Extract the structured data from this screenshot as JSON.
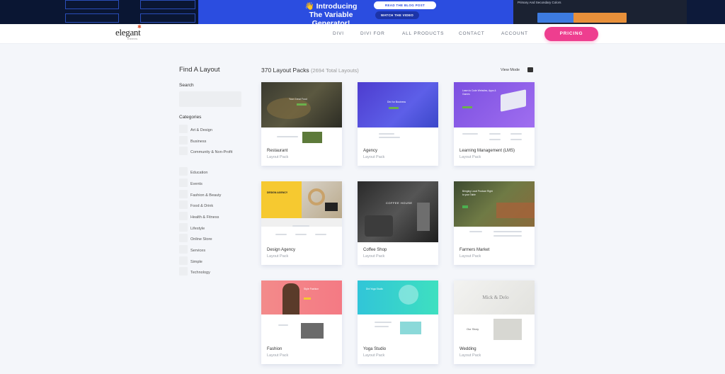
{
  "banner": {
    "title_line1": "👋 Introducing",
    "title_line2": "The Variable Generator!",
    "btn_blog": "READ THE BLOG POST",
    "btn_video": "WATCH THE VIDEO",
    "right_label": "Primary And Secondary Colors"
  },
  "nav": {
    "logo": "elegant",
    "logo_sub": "themes",
    "links": [
      "DIVI",
      "DIVI FOR",
      "ALL PRODUCTS",
      "CONTACT",
      "ACCOUNT"
    ],
    "pricing": "PRICING"
  },
  "sidebar": {
    "title": "Find A Layout",
    "search_label": "Search",
    "search_placeholder": "",
    "categories_label": "Categories",
    "categories": [
      "Art & Design",
      "Business",
      "Community & Non-Profit",
      "Education",
      "Events",
      "Fashion & Beauty",
      "Food & Drink",
      "Health & Fitness",
      "Lifestyle",
      "Online Store",
      "Services",
      "Simple",
      "Technology"
    ]
  },
  "main": {
    "title": "370 Layout Packs",
    "total": "(2694 Total Layouts)",
    "view_mode": "View Mode",
    "cards": [
      {
        "name": "Restaurant",
        "type": "Layout Pack",
        "hero": "Your Great Food"
      },
      {
        "name": "Agency",
        "type": "Layout Pack",
        "hero": "Divi for Business"
      },
      {
        "name": "Learning Management (LMS)",
        "type": "Layout Pack",
        "hero": "Learn to Code Websites, Apps & Games"
      },
      {
        "name": "Design Agency",
        "type": "Layout Pack",
        "hero": "DESIGN AGENCY"
      },
      {
        "name": "Coffee Shop",
        "type": "Layout Pack",
        "hero": "COFFEE HOUSE"
      },
      {
        "name": "Farmers Market",
        "type": "Layout Pack",
        "hero": "Bringing Local Produce Right to your Table"
      },
      {
        "name": "Fashion",
        "type": "Layout Pack",
        "hero": "Style Fashion"
      },
      {
        "name": "Yoga Studio",
        "type": "Layout Pack",
        "hero": "Divi Yoga Studio"
      },
      {
        "name": "Wedding",
        "type": "Layout Pack",
        "hero": "Mick & Delo"
      }
    ]
  },
  "colors": {
    "accent_pink": "#ee3e8f",
    "banner_blue": "#2b4de0",
    "swatch_blue": "#3d7be0",
    "swatch_orange": "#e8903a"
  }
}
